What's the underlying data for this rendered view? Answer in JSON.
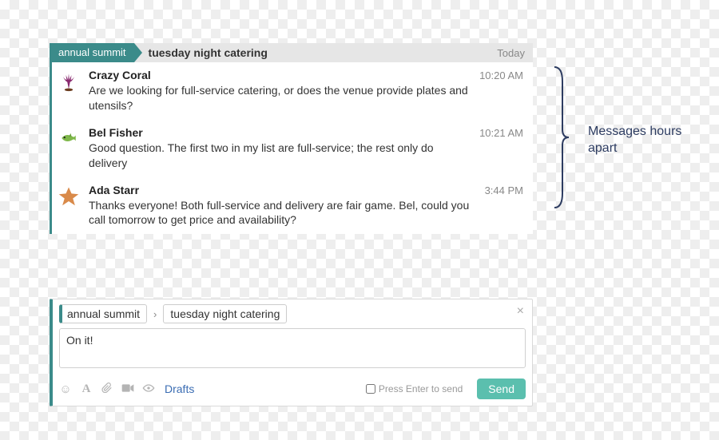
{
  "thread": {
    "parent": "annual summit",
    "topic": "tuesday night catering",
    "date_label": "Today",
    "messages": [
      {
        "author": "Crazy Coral",
        "time": "10:20 AM",
        "text": "Are we looking for full-service catering, or does the venue provide plates and utensils?",
        "avatar": "coral"
      },
      {
        "author": "Bel Fisher",
        "time": "10:21 AM",
        "text": "Good question. The first two in my list are full-service; the rest only do delivery",
        "avatar": "fish"
      },
      {
        "author": "Ada Starr",
        "time": "3:44 PM",
        "text": "Thanks everyone! Both full-service and delivery are fair game. Bel, could you call tomorrow to get price and availability?",
        "avatar": "star"
      }
    ]
  },
  "annotation": {
    "text": "Messages hours apart"
  },
  "compose": {
    "parent_tag": "annual summit",
    "topic_tag": "tuesday night catering",
    "draft_text": "On it!",
    "drafts_label": "Drafts",
    "enter_hint": "Press Enter to send",
    "send_label": "Send"
  },
  "colors": {
    "accent": "#3b8b8a",
    "annotation": "#2d3c61",
    "send": "#5bbfae"
  }
}
